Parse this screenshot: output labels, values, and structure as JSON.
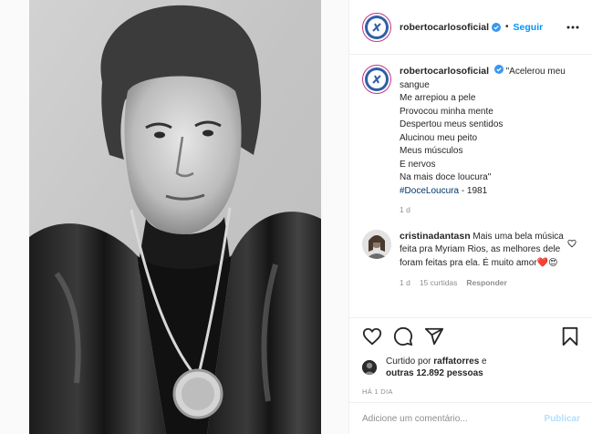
{
  "post": {
    "author": {
      "username": "robertocarlosoficial",
      "follow_label": "Seguir",
      "separator": "•"
    },
    "caption": {
      "username": "robertocarlosoficial",
      "lines": [
        "\"Acelerou meu",
        "sangue",
        "Me arrepiou a pele",
        "Provocou minha mente",
        "Despertou meus sentidos",
        "Alucinou meu peito",
        "Meus músculos",
        "E nervos",
        "Na mais doce loucura\""
      ],
      "hashtag": "#DoceLoucura",
      "suffix": " - 1981",
      "time": "1 d"
    },
    "comment": {
      "username": "cristinadantasn",
      "text": "Mais uma bela música feita pra Myriam Rios, as melhores dele foram feitas pra ela. É muito amor",
      "emoji": "❤️😍",
      "time": "1 d",
      "likes": "15 curtidas",
      "reply_label": "Responder"
    },
    "likes": {
      "prefix": "Curtido por ",
      "user": "raffatorres",
      "mid": " e",
      "others": "outras 12.892 pessoas"
    },
    "posted_time": "HÁ 1 DIA",
    "add_comment": {
      "placeholder": "Adicione um comentário...",
      "publish_label": "Publicar"
    }
  },
  "icons": {
    "verified": "verified-badge-icon",
    "more": "more-options-icon",
    "like": "heart-icon",
    "comment": "comment-icon",
    "share": "share-icon",
    "save": "bookmark-icon"
  },
  "colors": {
    "link": "#0095f6",
    "hashtag": "#00376b",
    "muted": "#8e8e8e",
    "border": "#efefef",
    "publish_disabled": "#b2dffc"
  }
}
